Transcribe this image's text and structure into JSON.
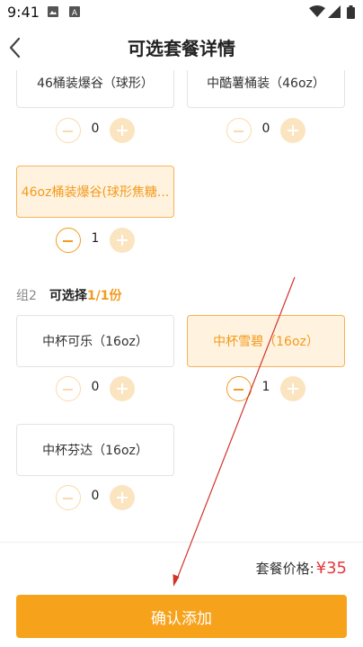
{
  "status_bar": {
    "time": "9:41"
  },
  "header": {
    "title": "可选套餐详情"
  },
  "group1": {
    "items": [
      {
        "name": "46桶装爆谷（球形）",
        "qty": "0",
        "selected": false
      },
      {
        "name": "中酷薯桶装（46oz）",
        "qty": "0",
        "selected": false
      },
      {
        "name": "46oz桶装爆谷(球形焦糖...",
        "qty": "1",
        "selected": true
      }
    ]
  },
  "group2": {
    "name": "组2",
    "select_label": "可选择",
    "count": "1/1份",
    "items": [
      {
        "name": "中杯可乐（16oz）",
        "qty": "0",
        "selected": false
      },
      {
        "name": "中杯雪碧（16oz）",
        "qty": "1",
        "selected": true
      },
      {
        "name": "中杯芬达（16oz）",
        "qty": "0",
        "selected": false
      }
    ]
  },
  "footer": {
    "price_label": "套餐价格:",
    "price_value": "¥35",
    "confirm_label": "确认添加"
  },
  "colors": {
    "accent": "#f7a21b",
    "price": "#e4393c",
    "selected_bg": "#fff3e0"
  }
}
